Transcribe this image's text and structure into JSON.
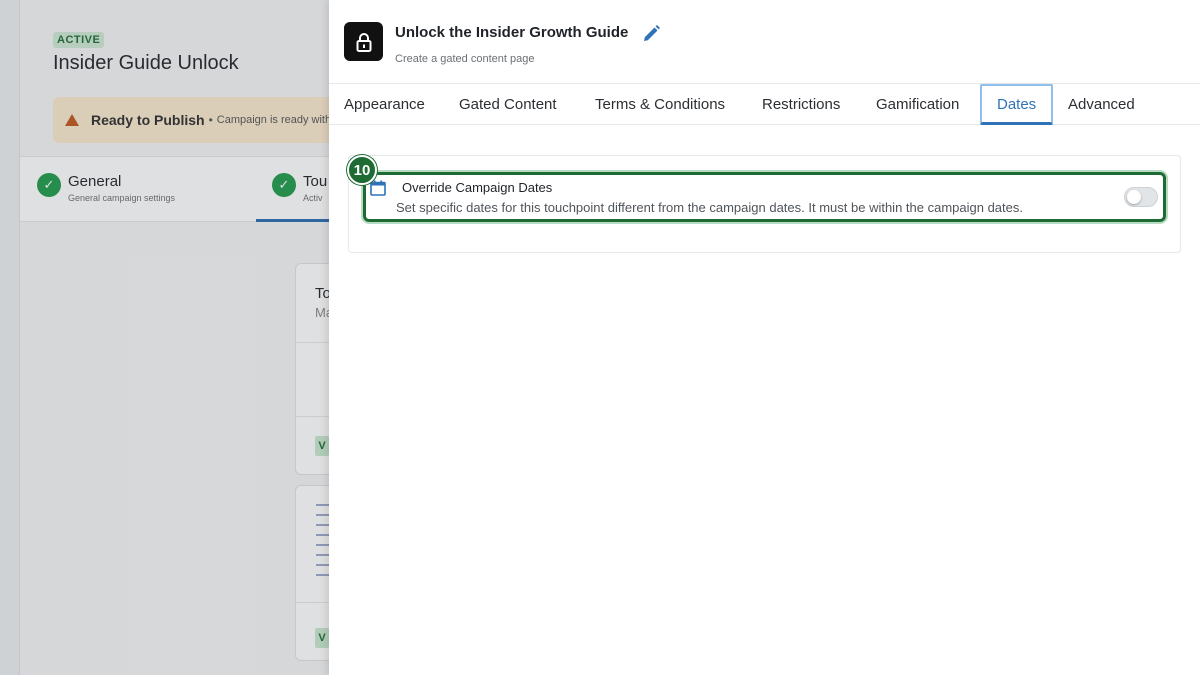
{
  "background": {
    "status_badge": "ACTIVE",
    "campaign_title": "Insider Guide Unlock",
    "warning": {
      "strong": "Ready to Publish",
      "separator": "•",
      "text": "Campaign is ready with"
    },
    "steps": [
      {
        "title": "General",
        "subtitle": "General campaign settings"
      },
      {
        "title": "Tou",
        "subtitle": "Activ"
      }
    ],
    "card1": {
      "title": "To",
      "subtitle": "Ma",
      "badge": "V"
    },
    "card2": {
      "badge": "V"
    }
  },
  "drawer": {
    "title": "Unlock the Insider Growth Guide",
    "subtitle": "Create a gated content page",
    "icons": {
      "header": "lock-icon",
      "edit": "pencil-icon",
      "dates": "calendar-icon"
    },
    "tabs": [
      {
        "label": "Appearance",
        "active": false
      },
      {
        "label": "Gated Content",
        "active": false
      },
      {
        "label": "Terms & Conditions",
        "active": false
      },
      {
        "label": "Restrictions",
        "active": false
      },
      {
        "label": "Gamification",
        "active": false
      },
      {
        "label": "Dates",
        "active": true
      },
      {
        "label": "Advanced",
        "active": false
      }
    ],
    "override": {
      "title": "Override Campaign Dates",
      "description": "Set specific dates for this touchpoint different from the campaign dates. It must be within the campaign dates.",
      "enabled": false
    },
    "step_marker": "10"
  },
  "colors": {
    "accent": "#2f72b8",
    "highlight": "#1e6b34",
    "active_badge_bg": "#cfe8d4",
    "warning_bg": "#fbe9cf"
  }
}
